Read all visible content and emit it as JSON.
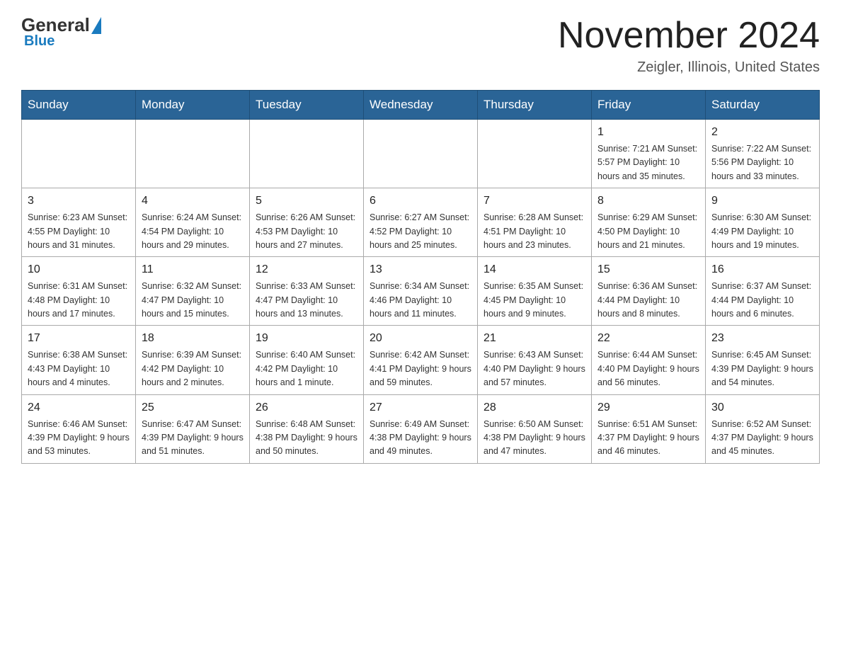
{
  "header": {
    "logo_general": "General",
    "logo_blue": "Blue",
    "main_title": "November 2024",
    "subtitle": "Zeigler, Illinois, United States"
  },
  "calendar": {
    "days_of_week": [
      "Sunday",
      "Monday",
      "Tuesday",
      "Wednesday",
      "Thursday",
      "Friday",
      "Saturday"
    ],
    "weeks": [
      [
        {
          "day": "",
          "info": ""
        },
        {
          "day": "",
          "info": ""
        },
        {
          "day": "",
          "info": ""
        },
        {
          "day": "",
          "info": ""
        },
        {
          "day": "",
          "info": ""
        },
        {
          "day": "1",
          "info": "Sunrise: 7:21 AM\nSunset: 5:57 PM\nDaylight: 10 hours and 35 minutes."
        },
        {
          "day": "2",
          "info": "Sunrise: 7:22 AM\nSunset: 5:56 PM\nDaylight: 10 hours and 33 minutes."
        }
      ],
      [
        {
          "day": "3",
          "info": "Sunrise: 6:23 AM\nSunset: 4:55 PM\nDaylight: 10 hours and 31 minutes."
        },
        {
          "day": "4",
          "info": "Sunrise: 6:24 AM\nSunset: 4:54 PM\nDaylight: 10 hours and 29 minutes."
        },
        {
          "day": "5",
          "info": "Sunrise: 6:26 AM\nSunset: 4:53 PM\nDaylight: 10 hours and 27 minutes."
        },
        {
          "day": "6",
          "info": "Sunrise: 6:27 AM\nSunset: 4:52 PM\nDaylight: 10 hours and 25 minutes."
        },
        {
          "day": "7",
          "info": "Sunrise: 6:28 AM\nSunset: 4:51 PM\nDaylight: 10 hours and 23 minutes."
        },
        {
          "day": "8",
          "info": "Sunrise: 6:29 AM\nSunset: 4:50 PM\nDaylight: 10 hours and 21 minutes."
        },
        {
          "day": "9",
          "info": "Sunrise: 6:30 AM\nSunset: 4:49 PM\nDaylight: 10 hours and 19 minutes."
        }
      ],
      [
        {
          "day": "10",
          "info": "Sunrise: 6:31 AM\nSunset: 4:48 PM\nDaylight: 10 hours and 17 minutes."
        },
        {
          "day": "11",
          "info": "Sunrise: 6:32 AM\nSunset: 4:47 PM\nDaylight: 10 hours and 15 minutes."
        },
        {
          "day": "12",
          "info": "Sunrise: 6:33 AM\nSunset: 4:47 PM\nDaylight: 10 hours and 13 minutes."
        },
        {
          "day": "13",
          "info": "Sunrise: 6:34 AM\nSunset: 4:46 PM\nDaylight: 10 hours and 11 minutes."
        },
        {
          "day": "14",
          "info": "Sunrise: 6:35 AM\nSunset: 4:45 PM\nDaylight: 10 hours and 9 minutes."
        },
        {
          "day": "15",
          "info": "Sunrise: 6:36 AM\nSunset: 4:44 PM\nDaylight: 10 hours and 8 minutes."
        },
        {
          "day": "16",
          "info": "Sunrise: 6:37 AM\nSunset: 4:44 PM\nDaylight: 10 hours and 6 minutes."
        }
      ],
      [
        {
          "day": "17",
          "info": "Sunrise: 6:38 AM\nSunset: 4:43 PM\nDaylight: 10 hours and 4 minutes."
        },
        {
          "day": "18",
          "info": "Sunrise: 6:39 AM\nSunset: 4:42 PM\nDaylight: 10 hours and 2 minutes."
        },
        {
          "day": "19",
          "info": "Sunrise: 6:40 AM\nSunset: 4:42 PM\nDaylight: 10 hours and 1 minute."
        },
        {
          "day": "20",
          "info": "Sunrise: 6:42 AM\nSunset: 4:41 PM\nDaylight: 9 hours and 59 minutes."
        },
        {
          "day": "21",
          "info": "Sunrise: 6:43 AM\nSunset: 4:40 PM\nDaylight: 9 hours and 57 minutes."
        },
        {
          "day": "22",
          "info": "Sunrise: 6:44 AM\nSunset: 4:40 PM\nDaylight: 9 hours and 56 minutes."
        },
        {
          "day": "23",
          "info": "Sunrise: 6:45 AM\nSunset: 4:39 PM\nDaylight: 9 hours and 54 minutes."
        }
      ],
      [
        {
          "day": "24",
          "info": "Sunrise: 6:46 AM\nSunset: 4:39 PM\nDaylight: 9 hours and 53 minutes."
        },
        {
          "day": "25",
          "info": "Sunrise: 6:47 AM\nSunset: 4:39 PM\nDaylight: 9 hours and 51 minutes."
        },
        {
          "day": "26",
          "info": "Sunrise: 6:48 AM\nSunset: 4:38 PM\nDaylight: 9 hours and 50 minutes."
        },
        {
          "day": "27",
          "info": "Sunrise: 6:49 AM\nSunset: 4:38 PM\nDaylight: 9 hours and 49 minutes."
        },
        {
          "day": "28",
          "info": "Sunrise: 6:50 AM\nSunset: 4:38 PM\nDaylight: 9 hours and 47 minutes."
        },
        {
          "day": "29",
          "info": "Sunrise: 6:51 AM\nSunset: 4:37 PM\nDaylight: 9 hours and 46 minutes."
        },
        {
          "day": "30",
          "info": "Sunrise: 6:52 AM\nSunset: 4:37 PM\nDaylight: 9 hours and 45 minutes."
        }
      ]
    ]
  }
}
